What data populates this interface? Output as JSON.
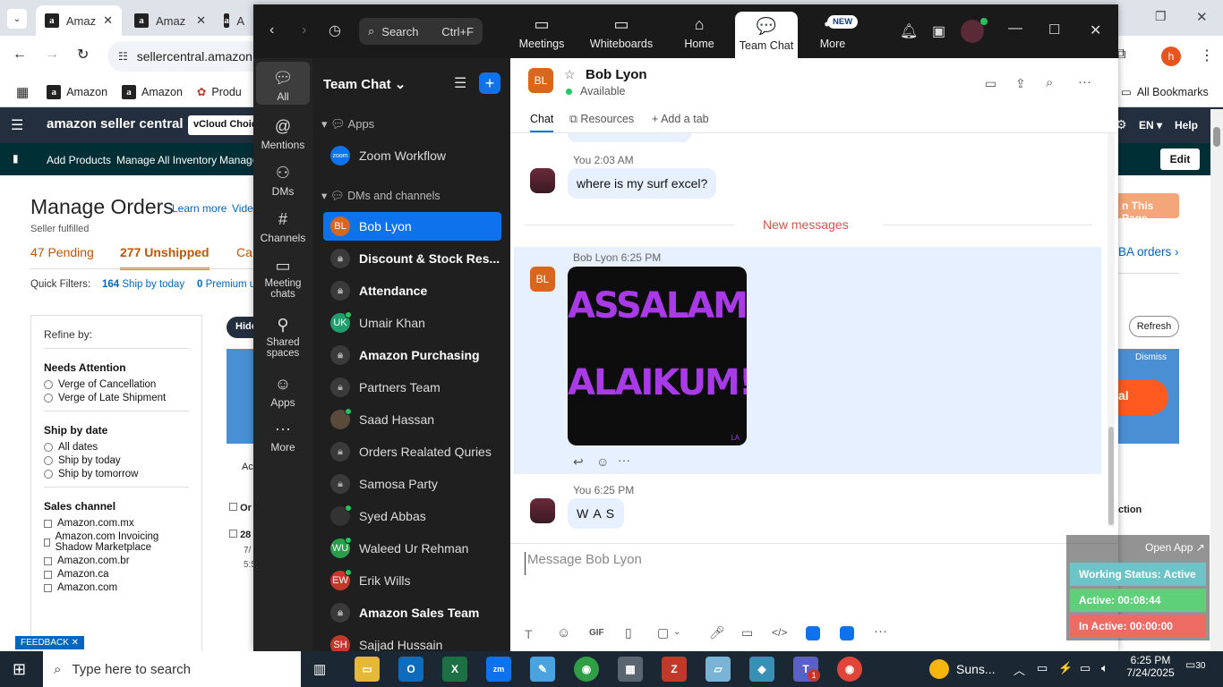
{
  "browser": {
    "tabs": [
      {
        "label": "Amaz",
        "active": true
      },
      {
        "label": "Amaz",
        "active": false
      },
      {
        "label": "A",
        "active": false
      }
    ],
    "url": "sellercentral.amazon",
    "profile_initial": "h",
    "bookmarks": [
      "Amazon",
      "Amazon",
      "Produ"
    ],
    "all_bookmarks": "All Bookmarks"
  },
  "seller": {
    "logo": "amazon seller central",
    "store": "vCloud Choic",
    "lang": "EN",
    "help": "Help",
    "nav": [
      "Add Products",
      "Manage All Inventory",
      "Manage"
    ],
    "edit": "Edit",
    "title": "Manage Orders",
    "learn_more": "Learn more",
    "video": "Vide",
    "subtitle": "Seller fulfilled",
    "pending": "47 Pending",
    "unshipped": "277 Unshipped",
    "canceled": "Ca",
    "quick_filters_label": "Quick Filters:",
    "qf1_count": "164",
    "qf1": "Ship by today",
    "qf2_count": "0",
    "qf2": "Premium u",
    "refine": "Refine by:",
    "needs_attention": "Needs Attention",
    "needs_options": [
      "Verge of Cancellation",
      "Verge of Late Shipment"
    ],
    "ship_by": "Ship by date",
    "ship_options": [
      "All dates",
      "Ship by today",
      "Ship by tomorrow"
    ],
    "sales_channel": "Sales channel",
    "channel_options": [
      "Amazon.com.mx",
      "Amazon.com Invoicing Shadow Marketplace",
      "Amazon.com.br",
      "Amazon.ca",
      "Amazon.com"
    ],
    "hide": "Hide",
    "page_btn": "n This Page",
    "fba_orders": "BA orders",
    "refresh": "Refresh",
    "dismiss": "Dismiss",
    "al": "al",
    "action": "ction",
    "ac": "Ac",
    "or": "Or",
    "row_num": "28",
    "row_date": "7/",
    "row_time": "5:5",
    "feedback": "FEEDBACK"
  },
  "zoom": {
    "search_placeholder": "Search",
    "search_shortcut": "Ctrl+F",
    "top_nav": [
      {
        "label": "Meetings",
        "icon": "camera-icon"
      },
      {
        "label": "Whiteboards",
        "icon": "whiteboard-icon"
      },
      {
        "label": "Home",
        "icon": "home-icon"
      },
      {
        "label": "Team Chat",
        "icon": "chat-icon"
      },
      {
        "label": "More",
        "icon": "more-icon"
      }
    ],
    "new_badge": "NEW",
    "rail": [
      "All",
      "Mentions",
      "DMs",
      "Channels",
      "Meeting chats",
      "Shared spaces",
      "Apps",
      "More"
    ],
    "list_title": "Team Chat",
    "apps_header": "Apps",
    "zoom_workflow": "Zoom Workflow",
    "dm_header": "DMs and channels",
    "channels": [
      {
        "name": "Bob Lyon",
        "initials": "BL",
        "type": "avatar",
        "color": "#d9661f",
        "bold": false,
        "selected": true,
        "online": false
      },
      {
        "name": "Discount & Stock Res...",
        "initials": "",
        "type": "lock",
        "color": "",
        "bold": true,
        "selected": false,
        "online": false
      },
      {
        "name": "Attendance",
        "initials": "",
        "type": "lock",
        "color": "",
        "bold": true,
        "selected": false,
        "online": false
      },
      {
        "name": "Umair Khan",
        "initials": "UK",
        "type": "avatar",
        "color": "#1f9e6e",
        "bold": false,
        "selected": false,
        "online": true
      },
      {
        "name": "Amazon Purchasing",
        "initials": "",
        "type": "lock",
        "color": "",
        "bold": true,
        "selected": false,
        "online": false
      },
      {
        "name": "Partners Team",
        "initials": "",
        "type": "lock",
        "color": "",
        "bold": false,
        "selected": false,
        "online": false
      },
      {
        "name": "Saad Hassan",
        "initials": "",
        "type": "photo",
        "color": "#5a4a3a",
        "bold": false,
        "selected": false,
        "online": true
      },
      {
        "name": "Orders Realated Quries",
        "initials": "",
        "type": "lock",
        "color": "",
        "bold": false,
        "selected": false,
        "online": false
      },
      {
        "name": "Samosa Party",
        "initials": "",
        "type": "lock",
        "color": "",
        "bold": false,
        "selected": false,
        "online": false
      },
      {
        "name": "Syed Abbas",
        "initials": "",
        "type": "photo",
        "color": "#333",
        "bold": false,
        "selected": false,
        "online": true
      },
      {
        "name": "Waleed Ur Rehman",
        "initials": "WU",
        "type": "avatar",
        "color": "#2a9d4a",
        "bold": false,
        "selected": false,
        "online": true
      },
      {
        "name": "Erik Wills",
        "initials": "EW",
        "type": "avatar",
        "color": "#c0392b",
        "bold": false,
        "selected": false,
        "online": true
      },
      {
        "name": "Amazon Sales Team",
        "initials": "",
        "type": "lock",
        "color": "",
        "bold": true,
        "selected": false,
        "online": false
      },
      {
        "name": "Sajjad Hussain",
        "initials": "SH",
        "type": "avatar",
        "color": "#c0392b",
        "bold": false,
        "selected": false,
        "online": false
      }
    ],
    "chat": {
      "contact": "Bob Lyon",
      "initials": "BL",
      "status": "Available",
      "tabs": [
        "Chat",
        "Resources",
        "Add a tab"
      ],
      "msg1_meta": "You 2:03 AM",
      "msg1": "where is my surf excel?",
      "new_messages": "New messages",
      "msg2_sender": "Bob Lyon",
      "msg2_time": "6:25 PM",
      "sticker_line1": "ASSALAMU",
      "sticker_line2": "ALAIKUM!",
      "sticker_sig": "LA",
      "msg3_meta": "You 6:25 PM",
      "msg3": "W A S",
      "compose_placeholder": "Message Bob Lyon"
    }
  },
  "status_widget": {
    "open_app": "Open App",
    "working": "Working Status: Active",
    "active": "Active: 00:08:44",
    "inactive": "In Active: 00:00:00"
  },
  "taskbar": {
    "search_placeholder": "Type here to search",
    "weather": "Suns...",
    "time": "6:25 PM",
    "date": "7/24/2025",
    "notif_count": "30",
    "teams_badge": "1"
  }
}
